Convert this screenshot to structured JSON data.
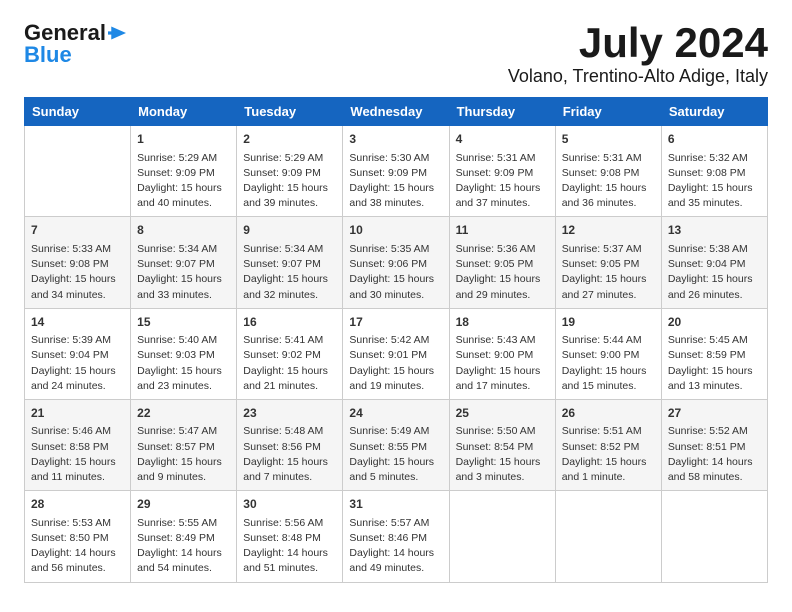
{
  "logo": {
    "line1": "General",
    "line2": "Blue",
    "arrow_color": "#1e88e5"
  },
  "title": "July 2024",
  "subtitle": "Volano, Trentino-Alto Adige, Italy",
  "days_header": [
    "Sunday",
    "Monday",
    "Tuesday",
    "Wednesday",
    "Thursday",
    "Friday",
    "Saturday"
  ],
  "weeks": [
    [
      {
        "num": "",
        "lines": []
      },
      {
        "num": "1",
        "lines": [
          "Sunrise: 5:29 AM",
          "Sunset: 9:09 PM",
          "Daylight: 15 hours",
          "and 40 minutes."
        ]
      },
      {
        "num": "2",
        "lines": [
          "Sunrise: 5:29 AM",
          "Sunset: 9:09 PM",
          "Daylight: 15 hours",
          "and 39 minutes."
        ]
      },
      {
        "num": "3",
        "lines": [
          "Sunrise: 5:30 AM",
          "Sunset: 9:09 PM",
          "Daylight: 15 hours",
          "and 38 minutes."
        ]
      },
      {
        "num": "4",
        "lines": [
          "Sunrise: 5:31 AM",
          "Sunset: 9:09 PM",
          "Daylight: 15 hours",
          "and 37 minutes."
        ]
      },
      {
        "num": "5",
        "lines": [
          "Sunrise: 5:31 AM",
          "Sunset: 9:08 PM",
          "Daylight: 15 hours",
          "and 36 minutes."
        ]
      },
      {
        "num": "6",
        "lines": [
          "Sunrise: 5:32 AM",
          "Sunset: 9:08 PM",
          "Daylight: 15 hours",
          "and 35 minutes."
        ]
      }
    ],
    [
      {
        "num": "7",
        "lines": [
          "Sunrise: 5:33 AM",
          "Sunset: 9:08 PM",
          "Daylight: 15 hours",
          "and 34 minutes."
        ]
      },
      {
        "num": "8",
        "lines": [
          "Sunrise: 5:34 AM",
          "Sunset: 9:07 PM",
          "Daylight: 15 hours",
          "and 33 minutes."
        ]
      },
      {
        "num": "9",
        "lines": [
          "Sunrise: 5:34 AM",
          "Sunset: 9:07 PM",
          "Daylight: 15 hours",
          "and 32 minutes."
        ]
      },
      {
        "num": "10",
        "lines": [
          "Sunrise: 5:35 AM",
          "Sunset: 9:06 PM",
          "Daylight: 15 hours",
          "and 30 minutes."
        ]
      },
      {
        "num": "11",
        "lines": [
          "Sunrise: 5:36 AM",
          "Sunset: 9:05 PM",
          "Daylight: 15 hours",
          "and 29 minutes."
        ]
      },
      {
        "num": "12",
        "lines": [
          "Sunrise: 5:37 AM",
          "Sunset: 9:05 PM",
          "Daylight: 15 hours",
          "and 27 minutes."
        ]
      },
      {
        "num": "13",
        "lines": [
          "Sunrise: 5:38 AM",
          "Sunset: 9:04 PM",
          "Daylight: 15 hours",
          "and 26 minutes."
        ]
      }
    ],
    [
      {
        "num": "14",
        "lines": [
          "Sunrise: 5:39 AM",
          "Sunset: 9:04 PM",
          "Daylight: 15 hours",
          "and 24 minutes."
        ]
      },
      {
        "num": "15",
        "lines": [
          "Sunrise: 5:40 AM",
          "Sunset: 9:03 PM",
          "Daylight: 15 hours",
          "and 23 minutes."
        ]
      },
      {
        "num": "16",
        "lines": [
          "Sunrise: 5:41 AM",
          "Sunset: 9:02 PM",
          "Daylight: 15 hours",
          "and 21 minutes."
        ]
      },
      {
        "num": "17",
        "lines": [
          "Sunrise: 5:42 AM",
          "Sunset: 9:01 PM",
          "Daylight: 15 hours",
          "and 19 minutes."
        ]
      },
      {
        "num": "18",
        "lines": [
          "Sunrise: 5:43 AM",
          "Sunset: 9:00 PM",
          "Daylight: 15 hours",
          "and 17 minutes."
        ]
      },
      {
        "num": "19",
        "lines": [
          "Sunrise: 5:44 AM",
          "Sunset: 9:00 PM",
          "Daylight: 15 hours",
          "and 15 minutes."
        ]
      },
      {
        "num": "20",
        "lines": [
          "Sunrise: 5:45 AM",
          "Sunset: 8:59 PM",
          "Daylight: 15 hours",
          "and 13 minutes."
        ]
      }
    ],
    [
      {
        "num": "21",
        "lines": [
          "Sunrise: 5:46 AM",
          "Sunset: 8:58 PM",
          "Daylight: 15 hours",
          "and 11 minutes."
        ]
      },
      {
        "num": "22",
        "lines": [
          "Sunrise: 5:47 AM",
          "Sunset: 8:57 PM",
          "Daylight: 15 hours",
          "and 9 minutes."
        ]
      },
      {
        "num": "23",
        "lines": [
          "Sunrise: 5:48 AM",
          "Sunset: 8:56 PM",
          "Daylight: 15 hours",
          "and 7 minutes."
        ]
      },
      {
        "num": "24",
        "lines": [
          "Sunrise: 5:49 AM",
          "Sunset: 8:55 PM",
          "Daylight: 15 hours",
          "and 5 minutes."
        ]
      },
      {
        "num": "25",
        "lines": [
          "Sunrise: 5:50 AM",
          "Sunset: 8:54 PM",
          "Daylight: 15 hours",
          "and 3 minutes."
        ]
      },
      {
        "num": "26",
        "lines": [
          "Sunrise: 5:51 AM",
          "Sunset: 8:52 PM",
          "Daylight: 15 hours",
          "and 1 minute."
        ]
      },
      {
        "num": "27",
        "lines": [
          "Sunrise: 5:52 AM",
          "Sunset: 8:51 PM",
          "Daylight: 14 hours",
          "and 58 minutes."
        ]
      }
    ],
    [
      {
        "num": "28",
        "lines": [
          "Sunrise: 5:53 AM",
          "Sunset: 8:50 PM",
          "Daylight: 14 hours",
          "and 56 minutes."
        ]
      },
      {
        "num": "29",
        "lines": [
          "Sunrise: 5:55 AM",
          "Sunset: 8:49 PM",
          "Daylight: 14 hours",
          "and 54 minutes."
        ]
      },
      {
        "num": "30",
        "lines": [
          "Sunrise: 5:56 AM",
          "Sunset: 8:48 PM",
          "Daylight: 14 hours",
          "and 51 minutes."
        ]
      },
      {
        "num": "31",
        "lines": [
          "Sunrise: 5:57 AM",
          "Sunset: 8:46 PM",
          "Daylight: 14 hours",
          "and 49 minutes."
        ]
      },
      {
        "num": "",
        "lines": []
      },
      {
        "num": "",
        "lines": []
      },
      {
        "num": "",
        "lines": []
      }
    ]
  ]
}
